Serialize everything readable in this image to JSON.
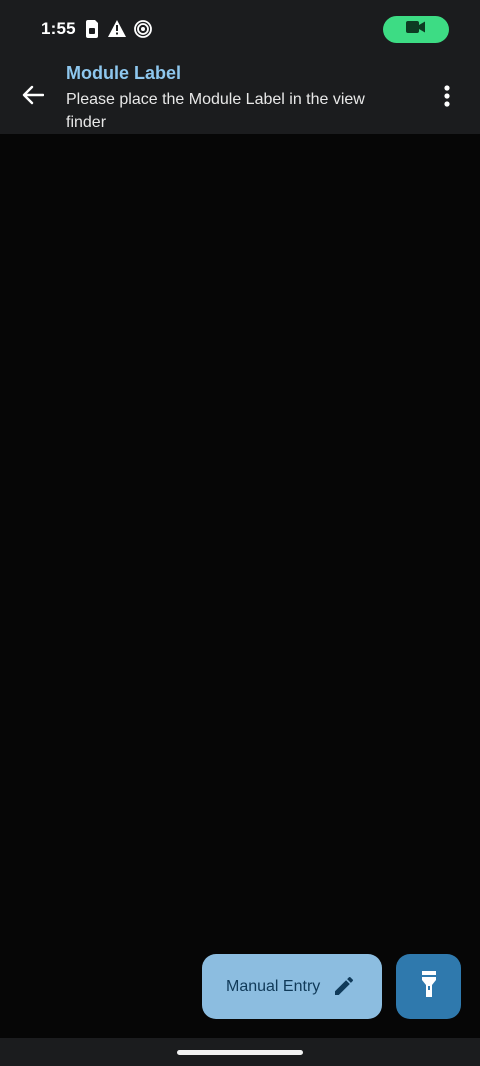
{
  "status_bar": {
    "time": "1:55",
    "icons": [
      "sim-card-icon",
      "warning-icon",
      "hotspot-icon"
    ],
    "camera_indicator_icon": "videocam-icon",
    "camera_indicator_color": "#3ddc84"
  },
  "app_bar": {
    "back_icon": "arrow-back-icon",
    "title": "Module Label",
    "subtitle": "Please place the Module Label in the view finder",
    "menu_icon": "more-vert-icon",
    "title_color": "#8ec7ee"
  },
  "actions": {
    "manual_entry_label": "Manual Entry",
    "manual_entry_icon": "pencil-icon",
    "manual_entry_color": "#8cbde0",
    "flashlight_icon": "flashlight-icon",
    "flashlight_color": "#2f79ad"
  }
}
